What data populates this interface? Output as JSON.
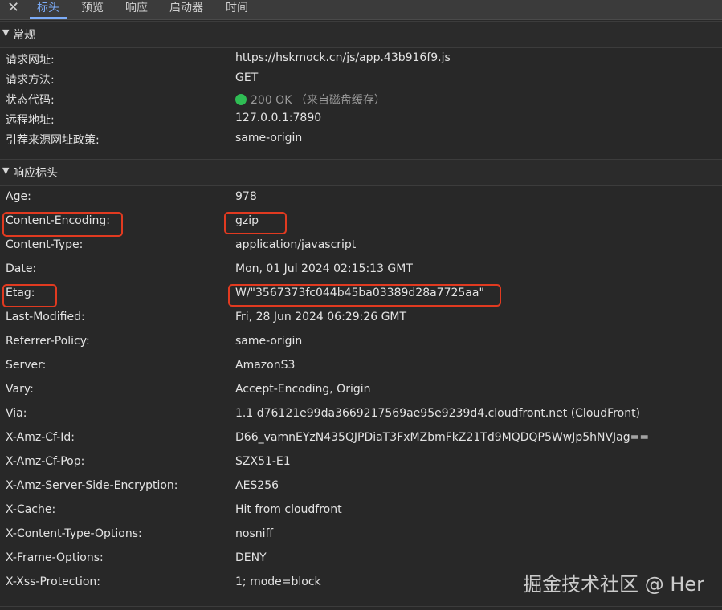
{
  "tabs": {
    "close": "✕",
    "items": [
      "标头",
      "预览",
      "响应",
      "启动器",
      "时间"
    ],
    "active_index": 0
  },
  "general": {
    "title": "常规",
    "rows": [
      {
        "key": "请求网址:",
        "value": "https://hskmock.cn/js/app.43b916f9.js"
      },
      {
        "key": "请求方法:",
        "value": "GET"
      },
      {
        "key": "状态代码:",
        "value": "200 OK （来自磁盘缓存）",
        "status_color": "#2fbd54"
      },
      {
        "key": "远程地址:",
        "value": "127.0.0.1:7890"
      },
      {
        "key": "引荐来源网址政策:",
        "value": "same-origin"
      }
    ]
  },
  "response_headers": {
    "title": "响应标头",
    "rows": [
      {
        "key": "Age:",
        "value": "978"
      },
      {
        "key": "Content-Encoding:",
        "value": "gzip",
        "highlighted": true
      },
      {
        "key": "Content-Type:",
        "value": "application/javascript"
      },
      {
        "key": "Date:",
        "value": "Mon, 01 Jul 2024 02:15:13 GMT"
      },
      {
        "key": "Etag:",
        "value": "W/\"3567373fc044b45ba03389d28a7725aa\"",
        "highlighted": true
      },
      {
        "key": "Last-Modified:",
        "value": "Fri, 28 Jun 2024 06:29:26 GMT"
      },
      {
        "key": "Referrer-Policy:",
        "value": "same-origin"
      },
      {
        "key": "Server:",
        "value": "AmazonS3"
      },
      {
        "key": "Vary:",
        "value": "Accept-Encoding, Origin"
      },
      {
        "key": "Via:",
        "value": "1.1 d76121e99da3669217569ae95e9239d4.cloudfront.net (CloudFront)"
      },
      {
        "key": "X-Amz-Cf-Id:",
        "value": "D66_vamnEYzN435QJPDiaT3FxMZbmFkZ21Td9MQDQP5WwJp5hNVJag=="
      },
      {
        "key": "X-Amz-Cf-Pop:",
        "value": "SZX51-E1"
      },
      {
        "key": "X-Amz-Server-Side-Encryption:",
        "value": "AES256"
      },
      {
        "key": "X-Cache:",
        "value": "Hit from cloudfront"
      },
      {
        "key": "X-Content-Type-Options:",
        "value": "nosniff"
      },
      {
        "key": "X-Frame-Options:",
        "value": "DENY"
      },
      {
        "key": "X-Xss-Protection:",
        "value": "1; mode=block"
      }
    ]
  },
  "highlight_color": "#e13a20",
  "watermark": "掘金技术社区 @ Her"
}
